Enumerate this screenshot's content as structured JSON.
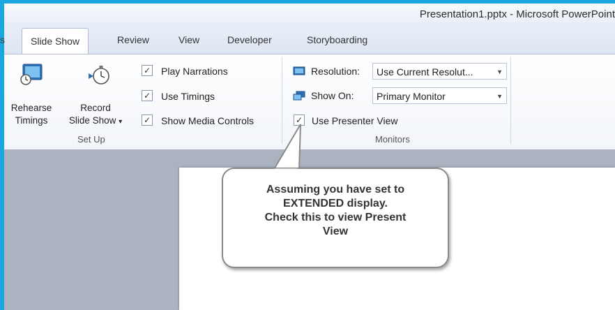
{
  "window": {
    "title": "Presentation1.pptx - Microsoft PowerPoint",
    "accent_color": "#1aa7df"
  },
  "tabs": {
    "fragment": "s",
    "items": [
      {
        "label": "Slide Show",
        "active": true
      },
      {
        "label": "Review"
      },
      {
        "label": "View"
      },
      {
        "label": "Developer"
      },
      {
        "label": "Storyboarding"
      }
    ]
  },
  "ribbon": {
    "setup_group": {
      "label": "Set Up",
      "rehearse": {
        "line1": "Rehearse",
        "line2": "Timings",
        "icon": "rehearse-timings-icon"
      },
      "record": {
        "line1": "Record",
        "line2": "Slide Show",
        "dropdown_glyph": "▾",
        "icon": "stopwatch-icon"
      },
      "checkboxes": [
        {
          "label": "Play Narrations",
          "checked": true
        },
        {
          "label": "Use Timings",
          "checked": true
        },
        {
          "label": "Show Media Controls",
          "checked": true
        }
      ]
    },
    "monitors_group": {
      "label": "Monitors",
      "resolution": {
        "label": "Resolution:",
        "value": "Use Current Resolut...",
        "icon": "resolution-icon"
      },
      "show_on": {
        "label": "Show On:",
        "value": "Primary Monitor",
        "icon": "monitor-icon"
      },
      "presenter_view": {
        "label": "Use Presenter View",
        "checked": true
      }
    }
  },
  "callout": {
    "text": "Assuming you have set to\nEXTENDED display.\nCheck this to view Present\nView"
  }
}
